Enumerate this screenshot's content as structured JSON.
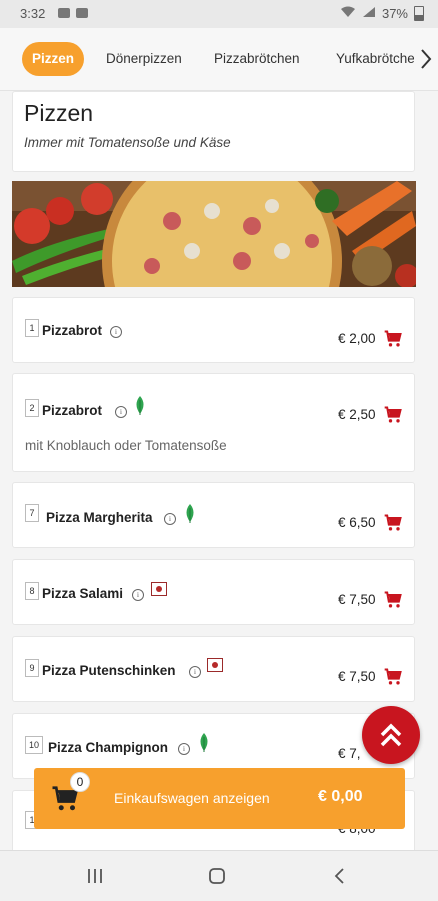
{
  "status_bar": {
    "time": "3:32",
    "battery": "37%"
  },
  "tabs": [
    {
      "label": "Pizzen"
    },
    {
      "label": "Dönerpizzen"
    },
    {
      "label": "Pizzabrötchen"
    },
    {
      "label": "Yufkabrötchen"
    }
  ],
  "section": {
    "title": "Pizzen",
    "subtitle": "Immer mit Tomatensoße und Käse"
  },
  "items": [
    {
      "number": "1",
      "name": "Pizzabrot",
      "price": "€ 2,00",
      "desc": ""
    },
    {
      "number": "2",
      "name": "Pizzabrot",
      "price": "€ 2,50",
      "desc": "mit Knoblauch oder Tomatensoße"
    },
    {
      "number": "7",
      "name": "Pizza Margherita",
      "price": "€ 6,50",
      "desc": ""
    },
    {
      "number": "8",
      "name": "Pizza Salami",
      "price": "€ 7,50",
      "desc": ""
    },
    {
      "number": "9",
      "name": "Pizza Putenschinken",
      "price": "€ 7,50",
      "desc": ""
    },
    {
      "number": "10",
      "name": "Pizza Champignon",
      "price": "€ 7,",
      "desc": ""
    },
    {
      "number": "1",
      "name": "",
      "price": "€ 8,00",
      "desc": ""
    }
  ],
  "cart": {
    "count": "0",
    "label": "Einkaufswagen anzeigen",
    "total": "€ 0,00"
  },
  "colors": {
    "accent": "#f7a02d",
    "cart_red": "#c8151f",
    "veg_green": "#2ea44f"
  }
}
